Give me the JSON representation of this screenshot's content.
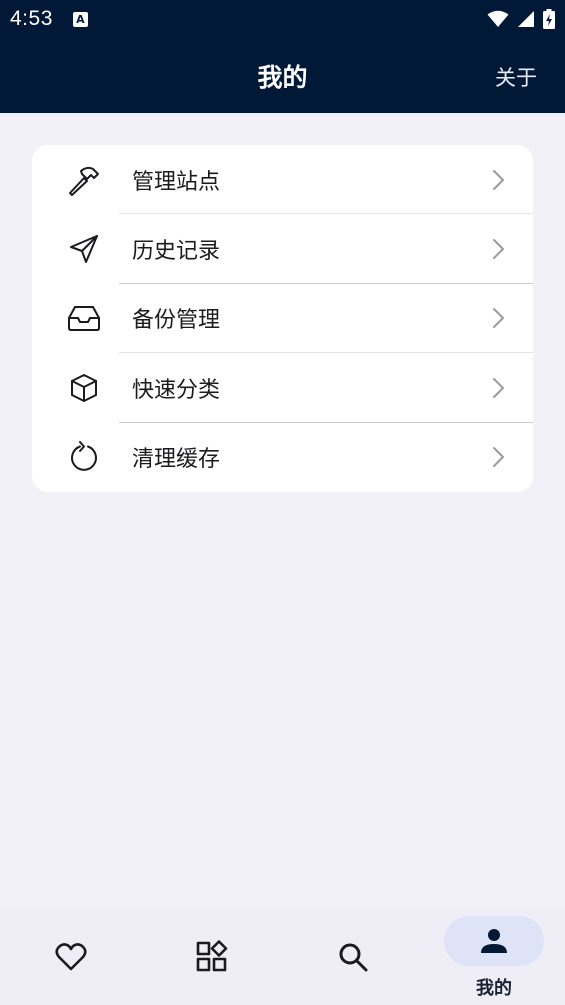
{
  "status": {
    "time": "4:53",
    "notification_glyph": "A"
  },
  "app_bar": {
    "title": "我的",
    "about": "关于"
  },
  "menu": {
    "items": [
      {
        "label": "管理站点",
        "icon": "hammer-icon"
      },
      {
        "label": "历史记录",
        "icon": "send-icon"
      },
      {
        "label": "备份管理",
        "icon": "inbox-icon"
      },
      {
        "label": "快速分类",
        "icon": "box-icon"
      },
      {
        "label": "清理缓存",
        "icon": "refresh-icon"
      }
    ]
  },
  "bottom_nav": {
    "items": [
      {
        "icon": "heart-icon"
      },
      {
        "icon": "apps-icon"
      },
      {
        "icon": "search-icon"
      },
      {
        "icon": "person-icon",
        "label": "我的",
        "active": true
      }
    ]
  },
  "colors": {
    "header_bg": "#011836",
    "page_bg": "#f2f1f8",
    "card_bg": "#ffffff",
    "nav_bg": "#efeef6",
    "nav_active_pill": "#dfe3f8"
  }
}
